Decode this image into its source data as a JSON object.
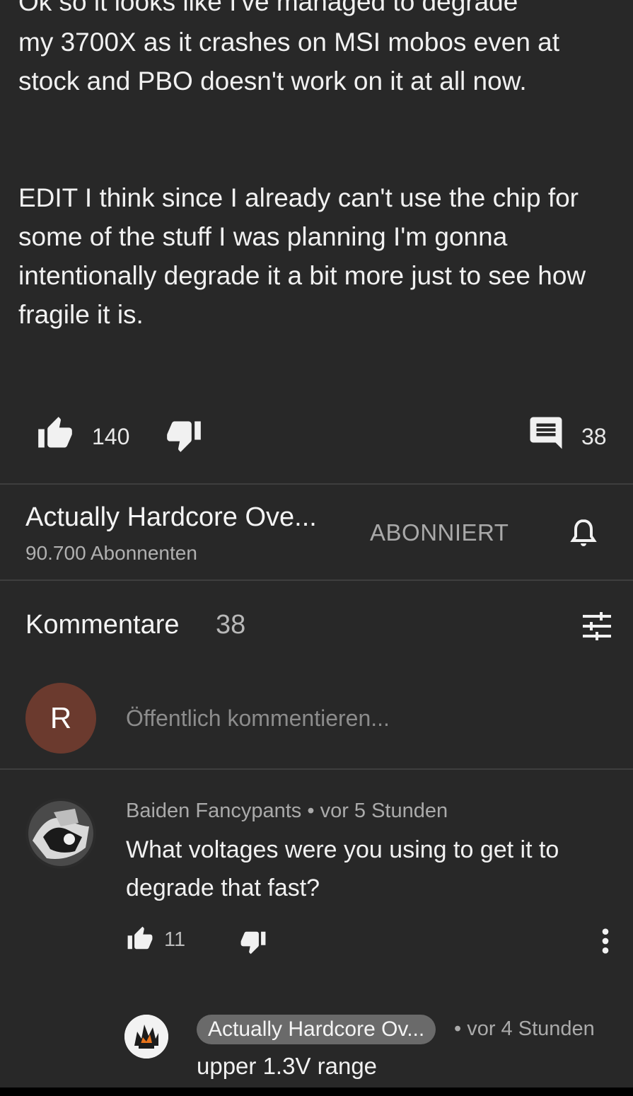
{
  "post": {
    "line_top_clipped": "Ok so it looks like I've managed to degrade",
    "paragraph1": "my 3700X as it crashes on MSI mobos even at stock and PBO doesn't work on it at all now.",
    "paragraph2": "EDIT I think since I already can't use the chip for some of the stuff I was planning I'm gonna intentionally degrade it a bit more just to see how fragile it is.",
    "likes": "140",
    "comments_count": "38"
  },
  "channel": {
    "name": "Actually Hardcore Ove...",
    "subscribers": "90.700 Abonnenten",
    "subscribe_state": "ABONNIERT"
  },
  "comments_section": {
    "title": "Kommentare",
    "count": "38",
    "composer_placeholder": "Öffentlich kommentieren...",
    "user_initial": "R"
  },
  "comment": {
    "author": "Baiden Fancypants",
    "time": "vor 5 Stunden",
    "text": "What voltages were you using to get it to degrade that fast?",
    "likes": "11"
  },
  "reply": {
    "author": "Actually Hardcore Ov...",
    "time": "vor 4 Stunden",
    "text": "upper 1.3V range"
  },
  "colors": {
    "background": "#282828",
    "avatar_r": "#6b3a2e",
    "chip": "#6a6a6a"
  }
}
